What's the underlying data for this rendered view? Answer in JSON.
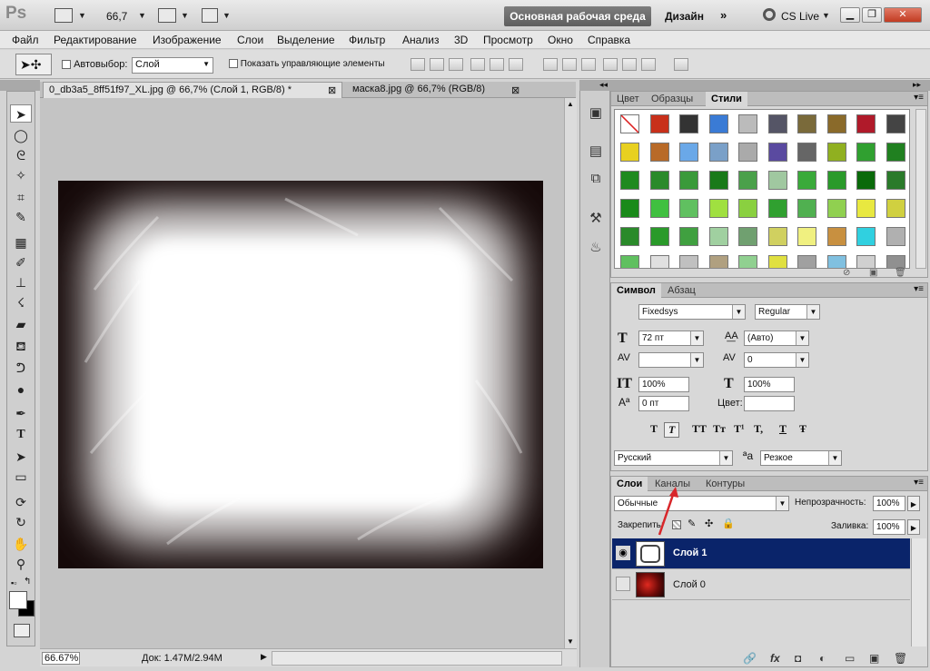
{
  "appbar": {
    "logo": "Ps",
    "zoom_display": "66,7",
    "workspace_active": "Основная рабочая среда",
    "workspace_other": "Дизайн",
    "more": "»",
    "cs_live": "CS Live",
    "window_min": "▁",
    "window_max": "❐",
    "window_close": "✕"
  },
  "menu": [
    "Файл",
    "Редактирование",
    "Изображение",
    "Слои",
    "Выделение",
    "Фильтр",
    "Анализ",
    "3D",
    "Просмотр",
    "Окно",
    "Справка"
  ],
  "options": {
    "autoselect_label": "Автовыбор:",
    "autoselect_value": "Слой",
    "show_controls_label": "Показать управляющие элементы"
  },
  "document": {
    "tabs": [
      {
        "label": "0_db3a5_8ff51f97_XL.jpg @ 66,7% (Слой 1, RGB/8) *",
        "close": "⊠"
      },
      {
        "label": "маска8.jpg @ 66,7% (RGB/8)",
        "close": "⊠"
      }
    ],
    "status_zoom": "66.67%",
    "status_doc": "Док: 1.47M/2.94M"
  },
  "styles_panel": {
    "tabs": [
      "Цвет",
      "Образцы",
      "Стили"
    ],
    "active_tab": "Стили"
  },
  "character_panel": {
    "tabs": [
      "Символ",
      "Абзац"
    ],
    "font_family": "Fixedsys",
    "font_style": "Regular",
    "font_size": "72 пт",
    "leading": "(Авто)",
    "kerning": "",
    "tracking": "0",
    "vscale": "100%",
    "hscale": "100%",
    "baseline": "0 пт",
    "color_label": "Цвет:",
    "format_buttons": [
      "T",
      "T",
      "TT",
      "Tт",
      "T¹",
      "T,",
      "T",
      "Ŧ"
    ],
    "language": "Русский",
    "antialias_icon": "ªa",
    "antialias": "Резкое"
  },
  "layers_panel": {
    "tabs": [
      "Слои",
      "Каналы",
      "Контуры"
    ],
    "blend_mode": "Обычные",
    "opacity_label": "Непрозрачность:",
    "opacity": "100%",
    "lock_label": "Закрепить:",
    "fill_label": "Заливка:",
    "fill": "100%",
    "layers": [
      {
        "name": "Слой 1",
        "selected": true,
        "visible": true
      },
      {
        "name": "Слой 0",
        "selected": false,
        "visible": false
      }
    ],
    "bottom_icons": [
      "🔗",
      "fx",
      "◘",
      "◐",
      "▭",
      "▣",
      "🗑"
    ]
  },
  "colors": {
    "accent": "#0a246a",
    "arrow": "#d8262a"
  }
}
